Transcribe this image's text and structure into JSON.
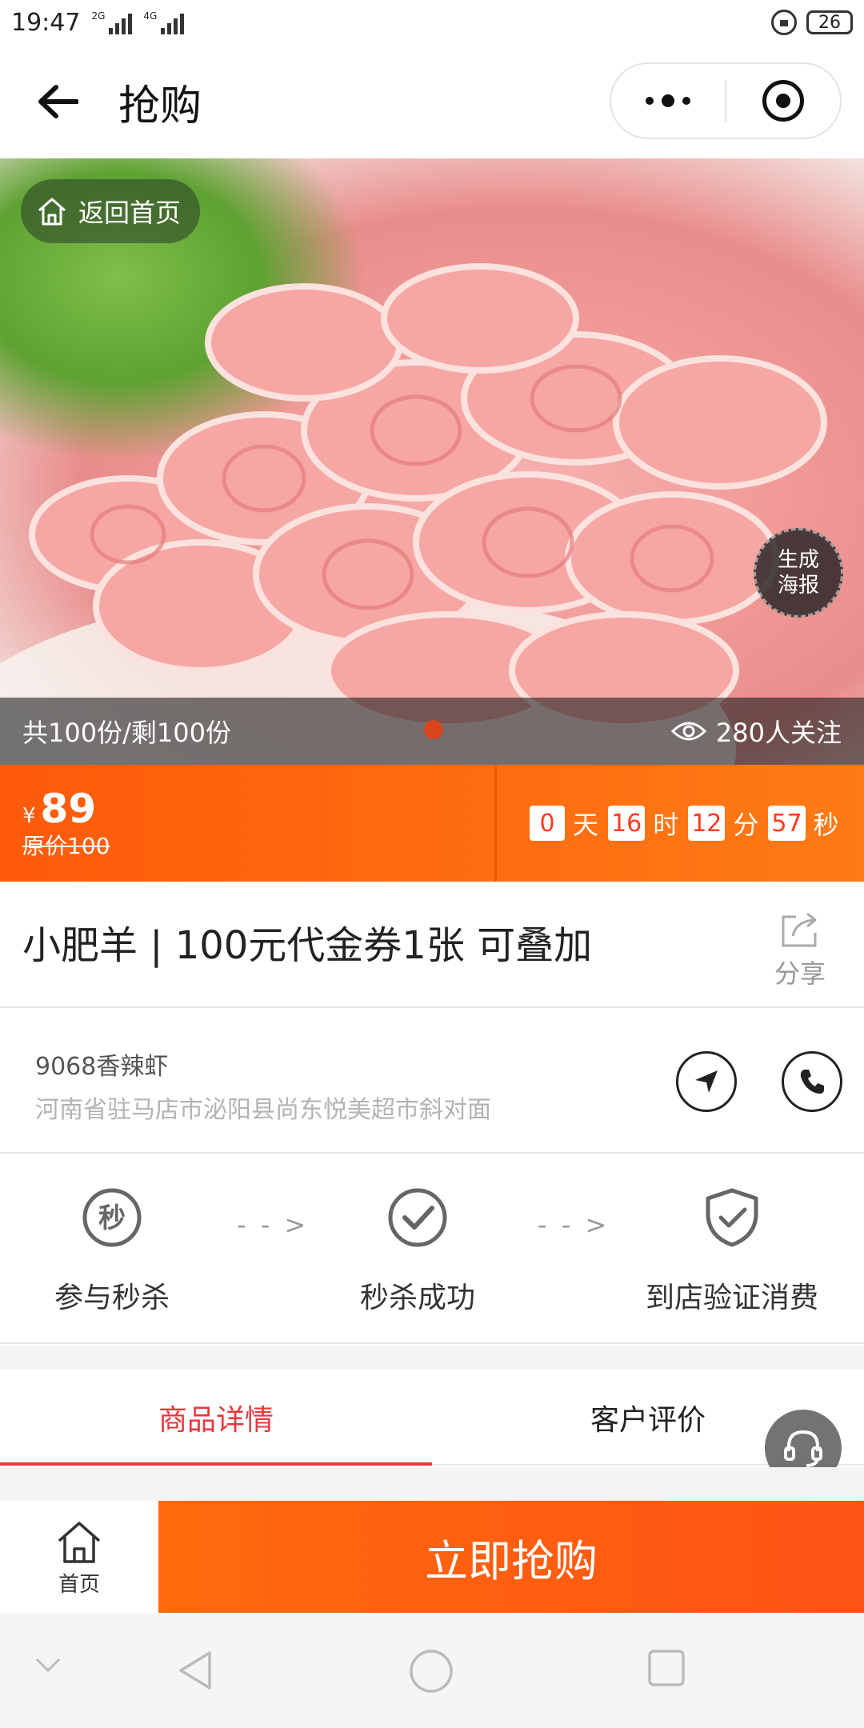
{
  "status_bar": {
    "time": "19:47",
    "signal1": "2G",
    "signal2": "4G",
    "battery": "26"
  },
  "nav": {
    "title": "抢购"
  },
  "hero": {
    "back_home_label": "返回首页",
    "poster_line1": "生成",
    "poster_line2": "海报",
    "stock_text": "共100份/剩100份",
    "views_text": "280人关注"
  },
  "price": {
    "currency": "¥",
    "current": "89",
    "original": "原价100",
    "countdown": [
      {
        "value": "0",
        "unit": "天"
      },
      {
        "value": "16",
        "unit": "时"
      },
      {
        "value": "12",
        "unit": "分"
      },
      {
        "value": "57",
        "unit": "秒"
      }
    ]
  },
  "product": {
    "title": "小肥羊 | 100元代金券1张 可叠加",
    "share_label": "分享"
  },
  "shop": {
    "name": "9068香辣虾",
    "address": "河南省驻马店市泌阳县尚东悦美超市斜对面"
  },
  "steps": [
    {
      "label": "参与秒杀",
      "icon": "seckill-icon"
    },
    {
      "label": "秒杀成功",
      "icon": "check-circle-icon"
    },
    {
      "label": "到店验证消费",
      "icon": "shield-check-icon"
    }
  ],
  "step_arrow": "- - >",
  "tabs": [
    {
      "label": "商品详情",
      "active": true
    },
    {
      "label": "客户评价",
      "active": false
    }
  ],
  "bottom": {
    "home_label": "首页",
    "buy_label": "立即抢购"
  },
  "colors": {
    "accent_orange": "#ff6a0c",
    "tab_red": "#e8373c"
  }
}
